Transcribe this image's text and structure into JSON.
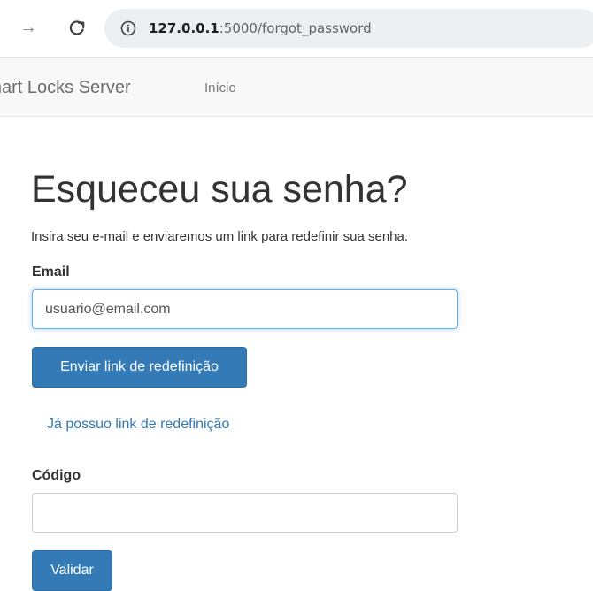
{
  "browser": {
    "url_host": "127.0.0.1",
    "url_rest": ":5000/forgot_password",
    "forward_icon": "arrow-right-icon",
    "reload_icon": "reload-icon",
    "site_info_icon": "info-circle-icon"
  },
  "navbar": {
    "brand": "Smart Locks Server",
    "links": [
      {
        "label": "Início"
      }
    ]
  },
  "main": {
    "title": "Esqueceu sua senha?",
    "intro": "Insira seu e-mail e enviaremos um link para redefinir sua senha.",
    "email_label": "Email",
    "email_value": "usuario@email.com",
    "send_button": "Enviar link de redefinição",
    "existing_link": "Já possuo link de redefinição",
    "code_label": "Código",
    "code_value": "",
    "validate_button": "Validar"
  },
  "colors": {
    "primary": "#337ab7",
    "navbar_bg": "#f8f8f8",
    "focus_border": "#66afe9"
  }
}
